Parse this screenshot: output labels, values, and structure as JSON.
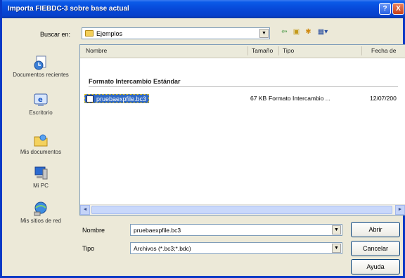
{
  "window": {
    "title": "Importa FIEBDC-3 sobre base actual",
    "help_glyph": "?",
    "close_glyph": "X"
  },
  "lookin": {
    "label": "Buscar en:",
    "value": "Ejemplos",
    "arrow_glyph": "▼"
  },
  "toolbar": {
    "back_glyph": "⇦",
    "up_glyph": "▣",
    "new_folder_glyph": "✱",
    "view_glyph": "▦▾"
  },
  "places": [
    {
      "label": "Documentos recientes"
    },
    {
      "label": "Escritorio"
    },
    {
      "label": "Mis documentos"
    },
    {
      "label": "Mi PC"
    },
    {
      "label": "Mis sitios de red"
    }
  ],
  "filelist": {
    "columns": [
      "Nombre",
      "Tamaño",
      "Tipo",
      "Fecha de"
    ],
    "group_title": "Formato Intercambio Estándar",
    "files": [
      {
        "name": "pruebaexpfile.bc3",
        "size": "67 KB",
        "type": "Formato Intercambio ...",
        "date": "12/07/200"
      }
    ],
    "scroll_left_glyph": "◄",
    "scroll_right_glyph": "►"
  },
  "form": {
    "name_label": "Nombre",
    "name_value": "pruebaexpfile.bc3",
    "type_label": "Tipo",
    "type_value": "Archivos (*.bc3;*.bdc)",
    "arrow_glyph": "▼",
    "open_label": "Abrir",
    "cancel_label": "Cancelar",
    "help_label": "Ayuda"
  },
  "colors": {
    "titlebar": "#0a5ae8",
    "selection": "#316ac5",
    "dialog_bg": "#ece9d8"
  }
}
